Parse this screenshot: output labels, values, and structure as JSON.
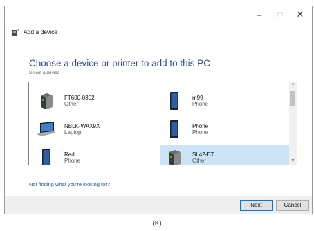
{
  "window": {
    "title": "Add a device",
    "controls": {
      "minimize": "–",
      "maximize": "□",
      "close": "✕"
    }
  },
  "heading": "Choose a device or printer to add to this PC",
  "subheading": "Select a device",
  "devices": [
    {
      "name": "FT600-0302",
      "type": "Other",
      "icon": "other-device-icon",
      "selected": false
    },
    {
      "name": "m99",
      "type": "Phone",
      "icon": "phone-icon",
      "selected": false
    },
    {
      "name": "NBLK-WAX9X",
      "type": "Laptop",
      "icon": "laptop-icon",
      "selected": false
    },
    {
      "name": "Phone",
      "type": "Phone",
      "icon": "phone-icon",
      "selected": false
    },
    {
      "name": "Red",
      "type": "Phone",
      "icon": "phone-icon",
      "selected": false
    },
    {
      "name": "SL42-BT",
      "type": "Other",
      "icon": "other-device-icon",
      "selected": true
    }
  ],
  "scrollbar": {
    "up": "^",
    "down": "v"
  },
  "help_link": "Not finding what you're looking for?",
  "buttons": {
    "next": "Next",
    "cancel": "Cancel"
  },
  "caption": "(K)",
  "colors": {
    "heading": "#2a4f8a",
    "link": "#1f5bb6",
    "selection": "#cce4f7",
    "footer": "#f0f0f0"
  }
}
